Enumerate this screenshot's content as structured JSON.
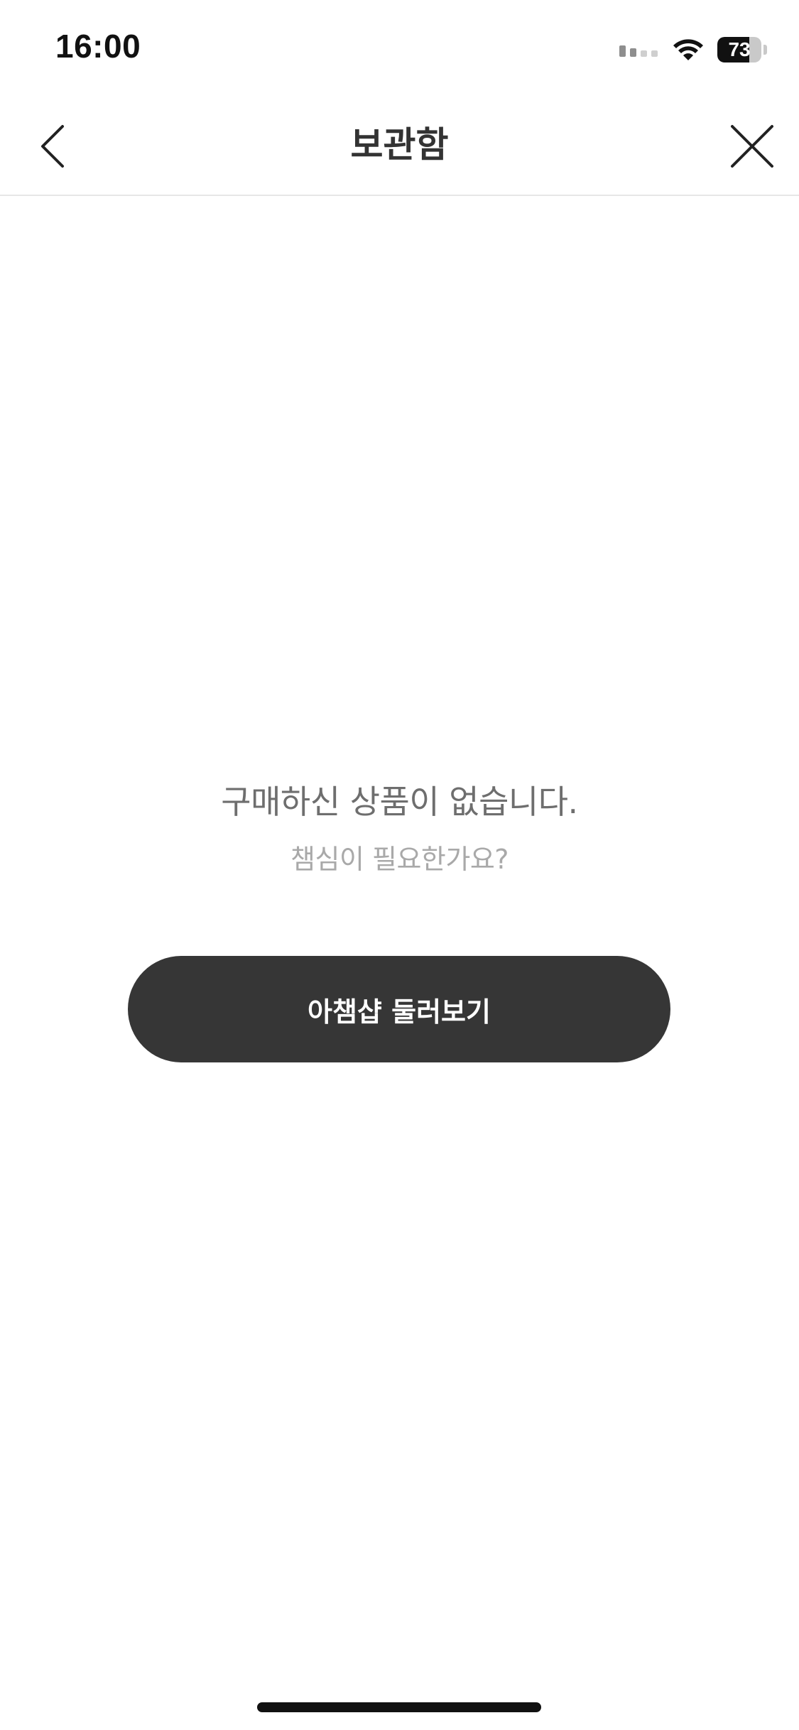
{
  "status_bar": {
    "time": "16:00",
    "battery_level": "73",
    "battery_percent": 73,
    "icons": [
      "cellular-signal-icon",
      "wifi-icon",
      "battery-icon"
    ]
  },
  "header": {
    "title": "보관함",
    "back_icon": "chevron-left-icon",
    "close_icon": "close-icon"
  },
  "empty_state": {
    "title": "구매하신 상품이 없습니다.",
    "subtitle": "챔심이 필요한가요?",
    "button_label": "아챔샵 둘러보기"
  },
  "colors": {
    "button_background": "#363636",
    "title_text": "#333333",
    "empty_title_text": "#6e6e6e",
    "empty_subtitle_text": "#a9a9a9"
  }
}
